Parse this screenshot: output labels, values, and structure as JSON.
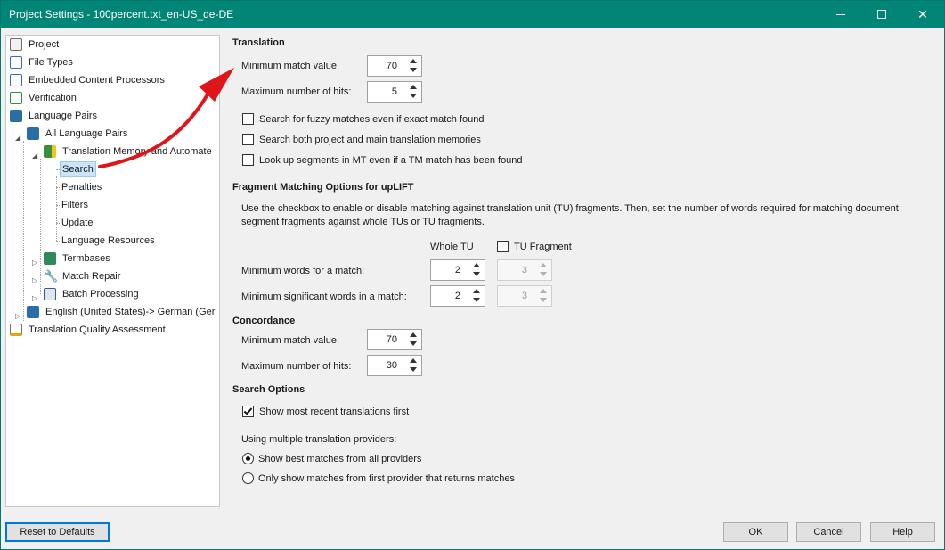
{
  "window": {
    "title": "Project Settings - 100percent.txt_en-US_de-DE"
  },
  "tree": {
    "project": "Project",
    "file_types": "File Types",
    "embedded": "Embedded Content Processors",
    "verification": "Verification",
    "language_pairs": "Language Pairs",
    "all_language_pairs": "All Language Pairs",
    "tm_automated": "Translation Memory and Automate",
    "search": "Search",
    "penalties": "Penalties",
    "filters": "Filters",
    "update": "Update",
    "language_resources": "Language Resources",
    "termbases": "Termbases",
    "match_repair": "Match Repair",
    "batch_processing": "Batch Processing",
    "english_german": "English (United States)-> German (Ger",
    "tqa": "Translation Quality Assessment"
  },
  "translation": {
    "title": "Translation",
    "min_match_label": "Minimum match value:",
    "min_match_value": "70",
    "max_hits_label": "Maximum number of hits:",
    "max_hits_value": "5",
    "fuzzy_label": "Search for fuzzy matches even if exact match found",
    "fuzzy_checked": false,
    "both_label": "Search both project and main translation memories",
    "both_checked": false,
    "mt_label": "Look up segments in MT even if a TM match has been found",
    "mt_checked": false
  },
  "fragment": {
    "title": "Fragment Matching Options for upLIFT",
    "desc_line1": "Use the checkbox to enable or disable matching against translation unit (TU)  fragments. Then, set the number of words required for matching document",
    "desc_line2": "segment fragments against whole TUs or TU fragments.",
    "whole_tu_header": "Whole TU",
    "tu_fragment_header": "TU Fragment",
    "tu_fragment_checked": false,
    "min_words_label": "Minimum words for a match:",
    "min_words_whole": "2",
    "min_words_fragment": "3",
    "min_sig_label": "Minimum significant words in a match:",
    "min_sig_whole": "2",
    "min_sig_fragment": "3"
  },
  "concordance": {
    "title": "Concordance",
    "min_match_label": "Minimum match value:",
    "min_match_value": "70",
    "max_hits_label": "Maximum number of hits:",
    "max_hits_value": "30"
  },
  "search_options": {
    "title": "Search Options",
    "recent_label": "Show most recent translations first",
    "recent_checked": true,
    "multi_label": "Using multiple translation providers:",
    "best_label": "Show best matches from all providers",
    "best_selected": true,
    "first_label": "Only show matches from first provider that returns matches",
    "first_selected": false
  },
  "buttons": {
    "reset": "Reset to Defaults",
    "ok": "OK",
    "cancel": "Cancel",
    "help": "Help"
  },
  "colors": {
    "titlebar": "#008577",
    "annotation_arrow": "#e0151b",
    "selection": "#cce4f7"
  }
}
